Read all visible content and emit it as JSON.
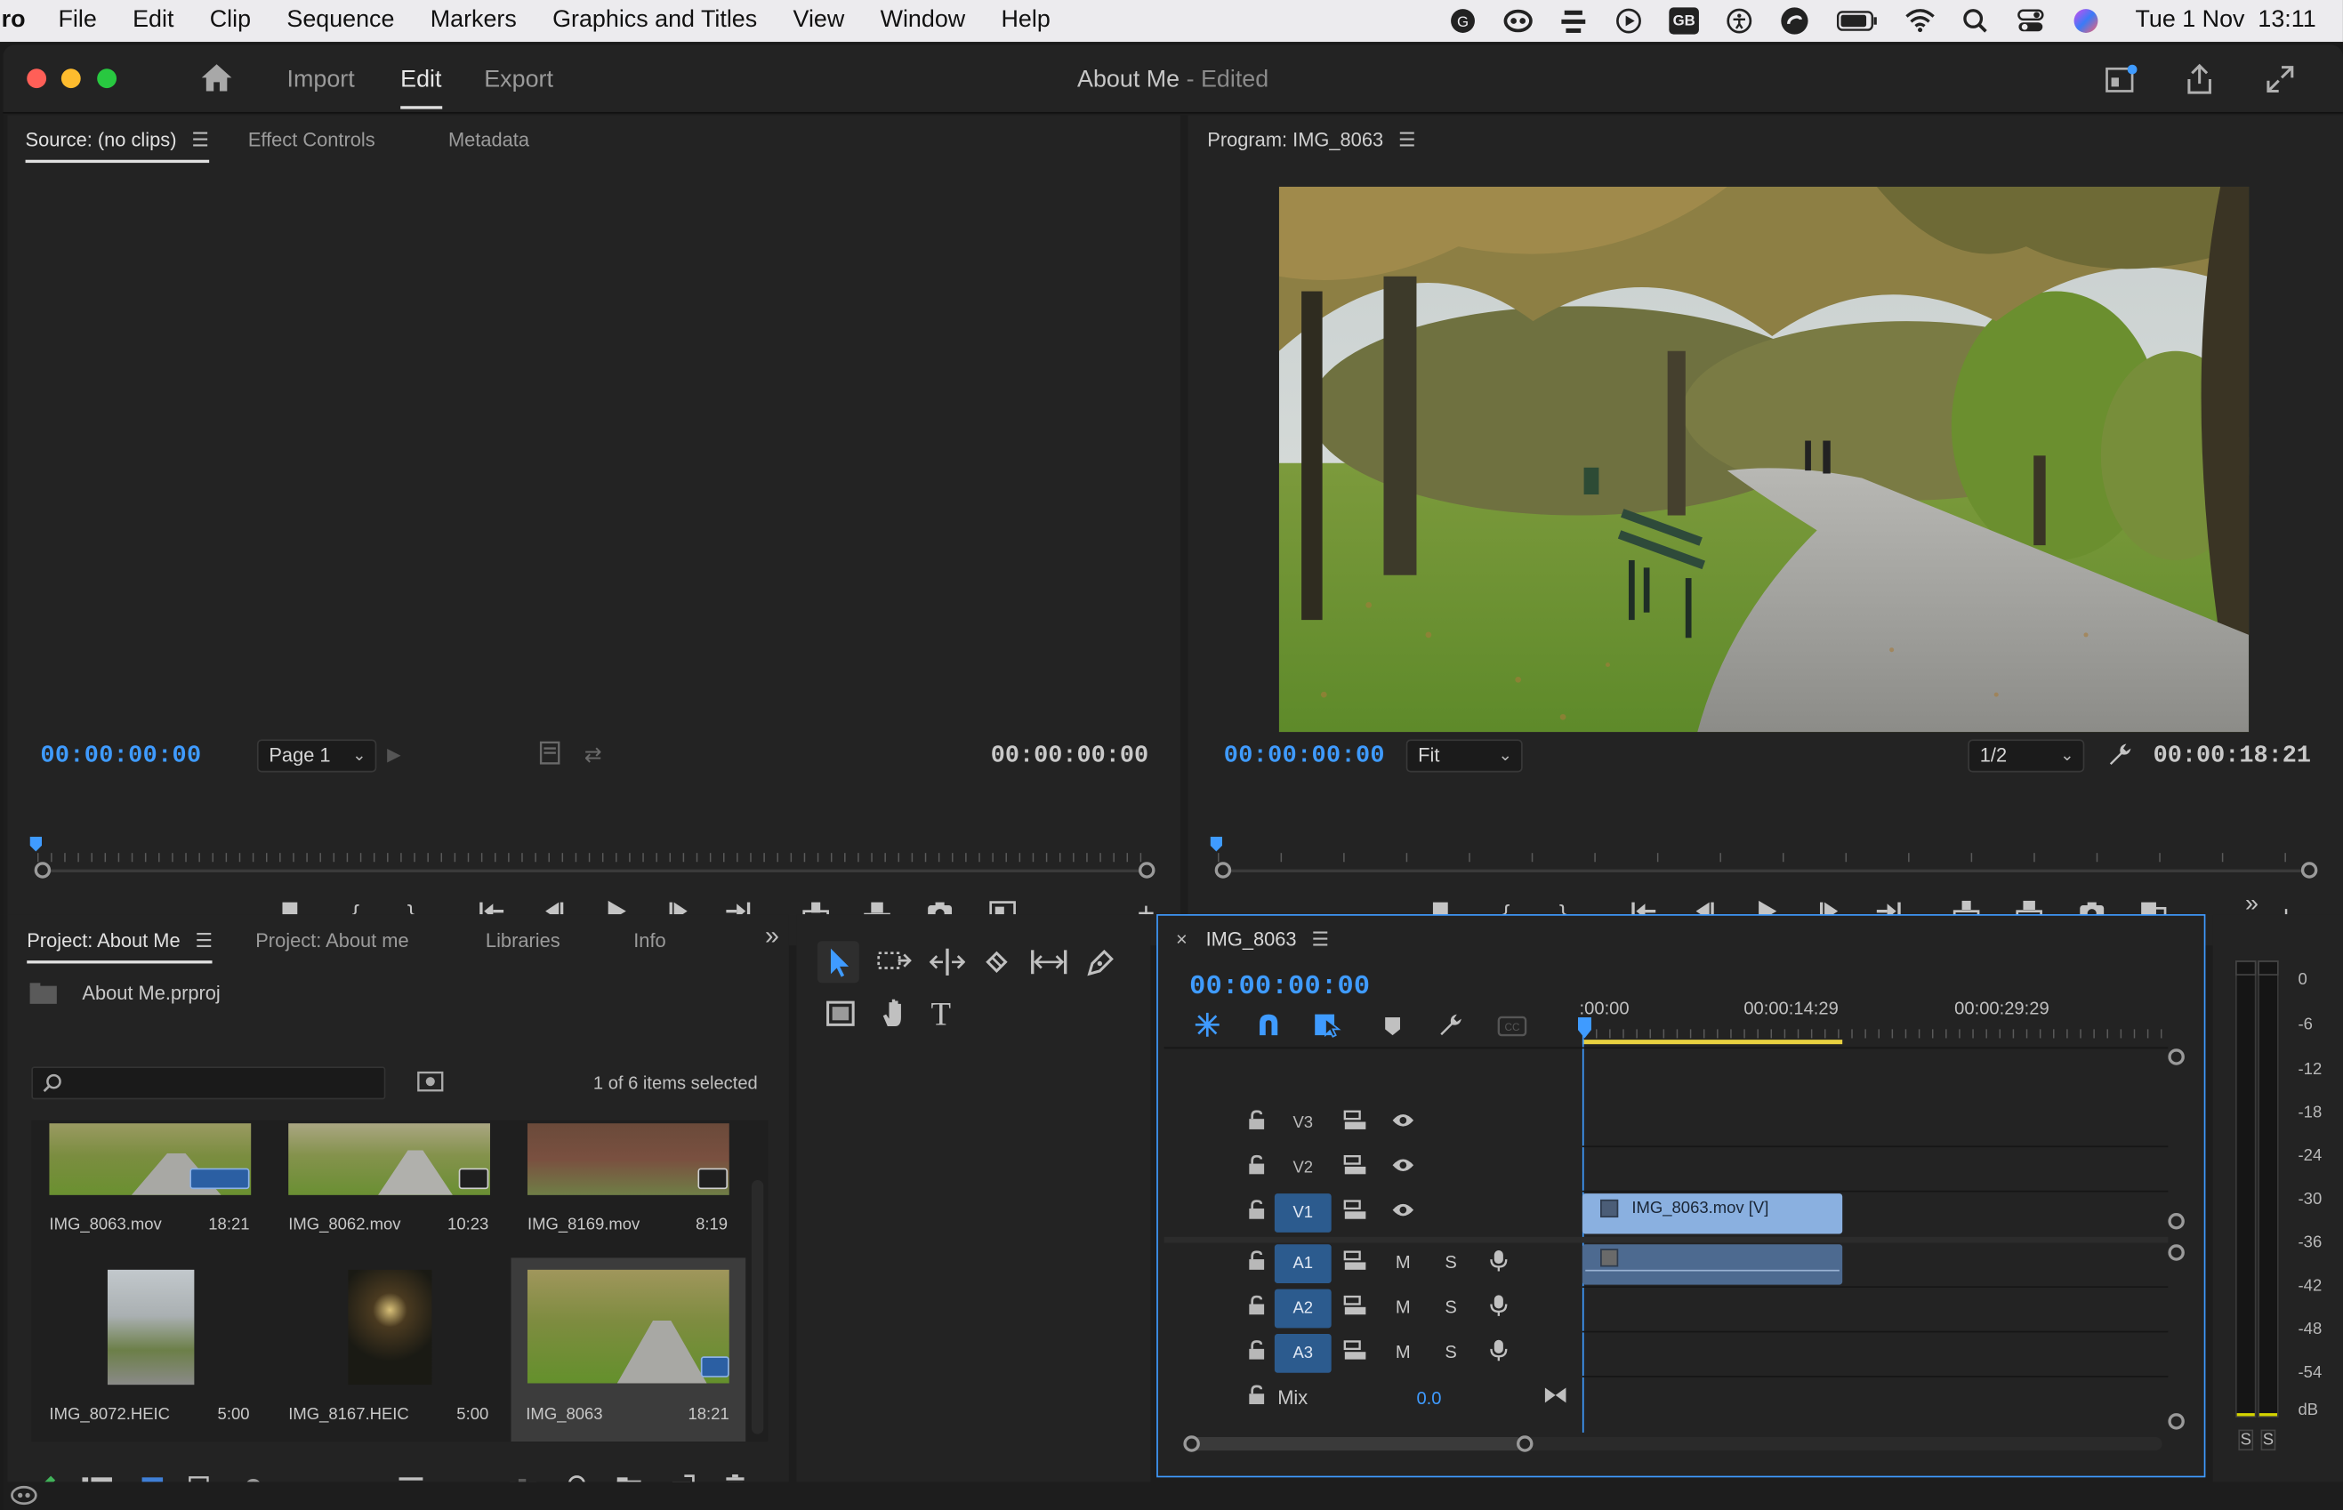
{
  "menubar": {
    "app_fragment": "ro",
    "items": [
      "File",
      "Edit",
      "Clip",
      "Sequence",
      "Markers",
      "Graphics and Titles",
      "View",
      "Window",
      "Help"
    ],
    "status_icons": [
      "antenna-icon",
      "creative-cloud-icon",
      "stack-icon",
      "play-circle-icon",
      "gb-input-icon",
      "accessibility-icon",
      "sync-icon",
      "battery-icon",
      "wifi-icon",
      "spotlight-icon",
      "control-center-icon",
      "siri-icon"
    ],
    "gb_label": "GB",
    "datetime": "Tue 1 Nov  13:11"
  },
  "titlebar": {
    "tabs": [
      "Import",
      "Edit",
      "Export"
    ],
    "active_tab": "Edit",
    "project_title": "About Me",
    "edited_suffix": " - Edited"
  },
  "source_panel": {
    "tabs": [
      "Source: (no clips)",
      "Effect Controls",
      "Metadata"
    ],
    "timecode_in": "00:00:00:00",
    "page_dropdown": "Page 1",
    "timecode_out": "00:00:00:00"
  },
  "program_panel": {
    "tab": "Program: IMG_8063",
    "timecode_in": "00:00:00:00",
    "fit_dropdown": "Fit",
    "resolution_dropdown": "1/2",
    "duration": "00:00:18:21"
  },
  "project_panel": {
    "tabs": [
      "Project: About Me",
      "Project: About me",
      "Libraries",
      "Info"
    ],
    "file_name": "About Me.prproj",
    "search_placeholder": "",
    "selection_status": "1 of 6 items selected",
    "items": [
      {
        "name": "IMG_8063.mov",
        "duration": "18:21"
      },
      {
        "name": "IMG_8062.mov",
        "duration": "10:23"
      },
      {
        "name": "IMG_8169.mov",
        "duration": "8:19"
      },
      {
        "name": "IMG_8072.HEIC",
        "duration": "5:00"
      },
      {
        "name": "IMG_8167.HEIC",
        "duration": "5:00"
      },
      {
        "name": "IMG_8063",
        "duration": "18:21"
      }
    ]
  },
  "timeline": {
    "sequence_name": "IMG_8063",
    "timecode": "00:00:00:00",
    "ruler_labels": [
      ":00:00",
      "00:00:14:29",
      "00:00:29:29"
    ],
    "video_tracks": [
      "V3",
      "V2",
      "V1"
    ],
    "audio_tracks": [
      "A1",
      "A2",
      "A3"
    ],
    "mute_label": "M",
    "solo_label": "S",
    "mix_label": "Mix",
    "mix_value": "0.0",
    "clip_label": "IMG_8063.mov [V]"
  },
  "audio_meter": {
    "scale": [
      "0",
      "-6",
      "-12",
      "-18",
      "-24",
      "-30",
      "-36",
      "-42",
      "-48",
      "-54",
      "dB"
    ],
    "solo_buttons": [
      "S",
      "S"
    ]
  },
  "colors": {
    "accent_blue": "#3f9bff",
    "track_blue": "#2c5b8e",
    "clip_blue": "#8ab0e0",
    "panel_bg": "#232323"
  }
}
